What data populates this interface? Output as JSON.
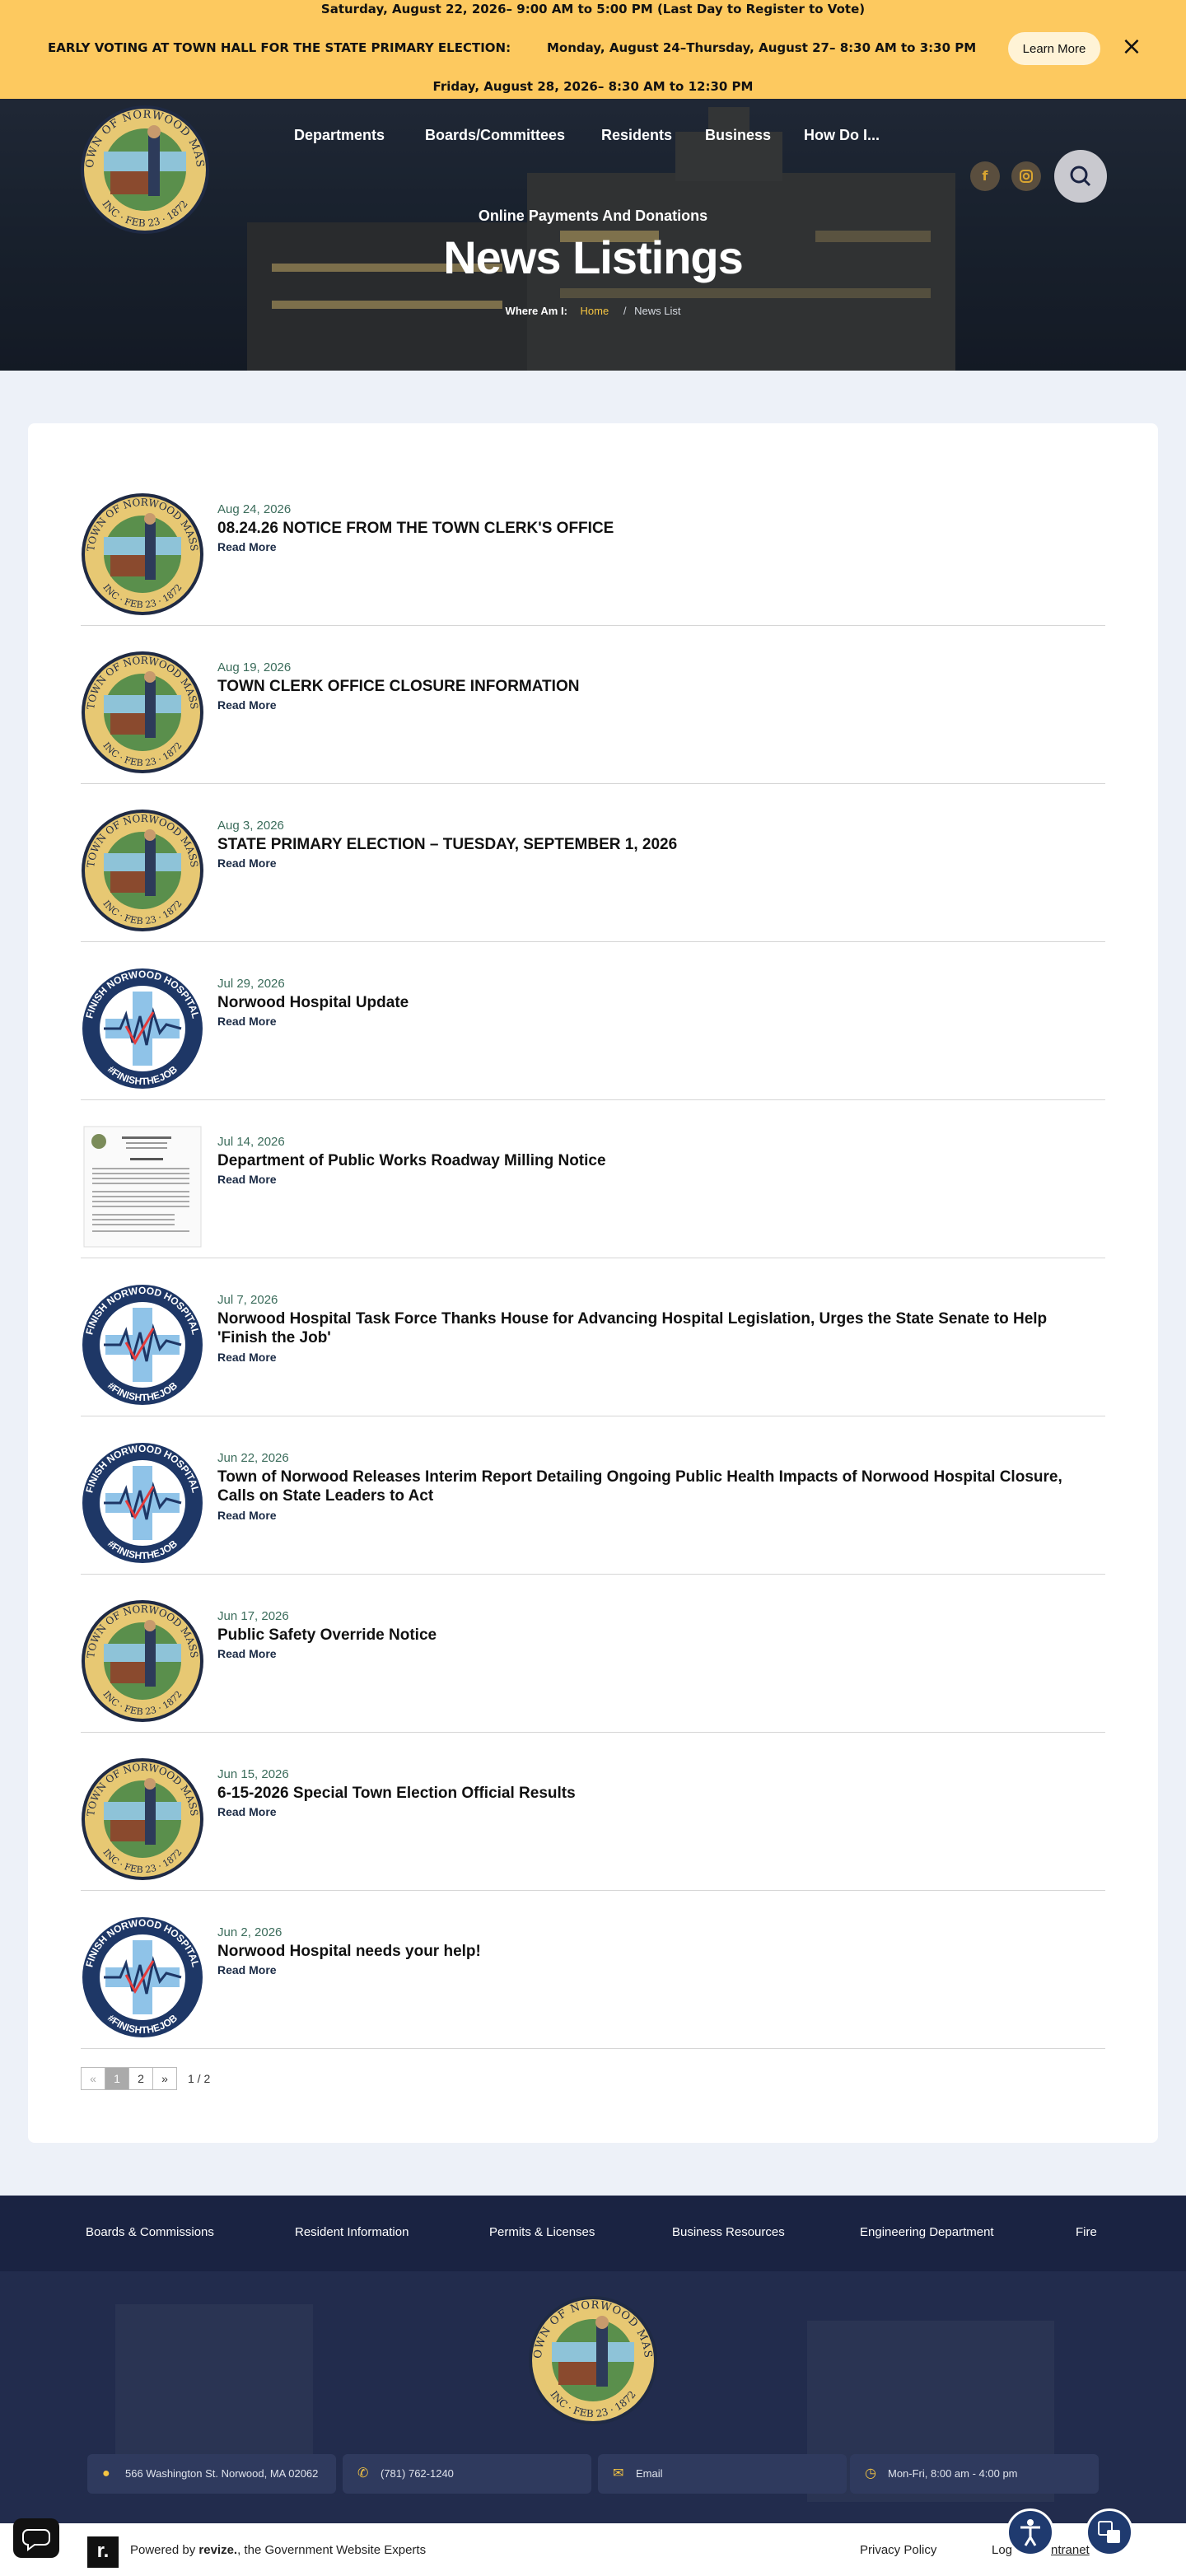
{
  "alert": {
    "line1": "Saturday, August 22, 2026– 9:00 AM to 5:00 PM (Last Day to Register to Vote)",
    "title": "EARLY VOTING AT TOWN HALL FOR THE STATE PRIMARY ELECTION:",
    "line2": "Monday, August 24–Thursday, August 27– 8:30 AM to 3:30 PM",
    "line3": "Friday, August 28, 2026– 8:30 AM to 12:30 PM",
    "learn_more": "Learn More"
  },
  "seal": {
    "ring_top": "TOWN OF NORWOOD MASS",
    "ring_bottom": "INC · FEB 23 · 1872"
  },
  "nav": {
    "items": [
      "Departments",
      "Boards/Committees",
      "Residents",
      "Business",
      "How Do I..."
    ]
  },
  "social": {
    "facebook": "f"
  },
  "hero": {
    "subtitle": "Online Payments And Donations",
    "title": "News Listings",
    "breadcrumb_label": "Where Am I:",
    "breadcrumb_home": "Home",
    "breadcrumb_sep": "/",
    "breadcrumb_current": "News List"
  },
  "news": {
    "read_more": "Read More",
    "items": [
      {
        "date": "Aug 24, 2026",
        "title": "08.24.26 NOTICE FROM THE TOWN CLERK'S OFFICE",
        "thumb": "seal"
      },
      {
        "date": "Aug 19, 2026",
        "title": "TOWN CLERK OFFICE CLOSURE INFORMATION",
        "thumb": "seal"
      },
      {
        "date": "Aug 3, 2026",
        "title": "STATE PRIMARY ELECTION – TUESDAY, SEPTEMBER 1, 2026",
        "thumb": "seal"
      },
      {
        "date": "Jul 29, 2026",
        "title": "Norwood Hospital Update",
        "thumb": "hospital"
      },
      {
        "date": "Jul 14, 2026",
        "title": "Department of Public Works Roadway Milling Notice",
        "thumb": "document"
      },
      {
        "date": "Jul 7, 2026",
        "title": "Norwood Hospital Task Force Thanks House for Advancing Hospital Legislation, Urges the State Senate to Help 'Finish the Job'",
        "thumb": "hospital"
      },
      {
        "date": "Jun 22, 2026",
        "title": "Town of Norwood Releases Interim Report Detailing Ongoing Public Health Impacts of Norwood Hospital Closure, Calls on State Leaders to Act",
        "thumb": "hospital"
      },
      {
        "date": "Jun 17, 2026",
        "title": "Public Safety Override Notice",
        "thumb": "seal"
      },
      {
        "date": "Jun 15, 2026",
        "title": "6-15-2026 Special Town Election Official Results",
        "thumb": "seal"
      },
      {
        "date": "Jun 2, 2026",
        "title": "Norwood Hospital needs your help!",
        "thumb": "hospital"
      }
    ]
  },
  "hospital_badge": {
    "top": "FINISH NORWOOD HOSPITAL",
    "bottom": "#FINISHTHEJOB"
  },
  "pagination": {
    "prev": "«",
    "pages": [
      "1",
      "2"
    ],
    "next": "»",
    "info": "1 / 2",
    "current": 1
  },
  "footer": {
    "nav": [
      "Boards & Commissions",
      "Resident Information",
      "Permits & Licenses",
      "Business Resources",
      "Engineering Department",
      "Fire"
    ],
    "address": "566 Washington St. Norwood, MA 02062",
    "phone": "(781) 762-1240",
    "email": "Email",
    "hours": "Mon-Fri, 8:00 am - 4:00 pm",
    "powered_pre": "Powered by ",
    "powered_brand": "revize.",
    "powered_post": ", the Government Website Experts",
    "privacy": "Privacy Policy",
    "login": "Log",
    "login_tail": "ntranet",
    "revize_mark": "r."
  },
  "colors": {
    "alert_bg": "#fdc95f",
    "footer_bg": "#222c4d",
    "accent_gold": "#f5c542",
    "date_green": "#3a6b5a"
  }
}
